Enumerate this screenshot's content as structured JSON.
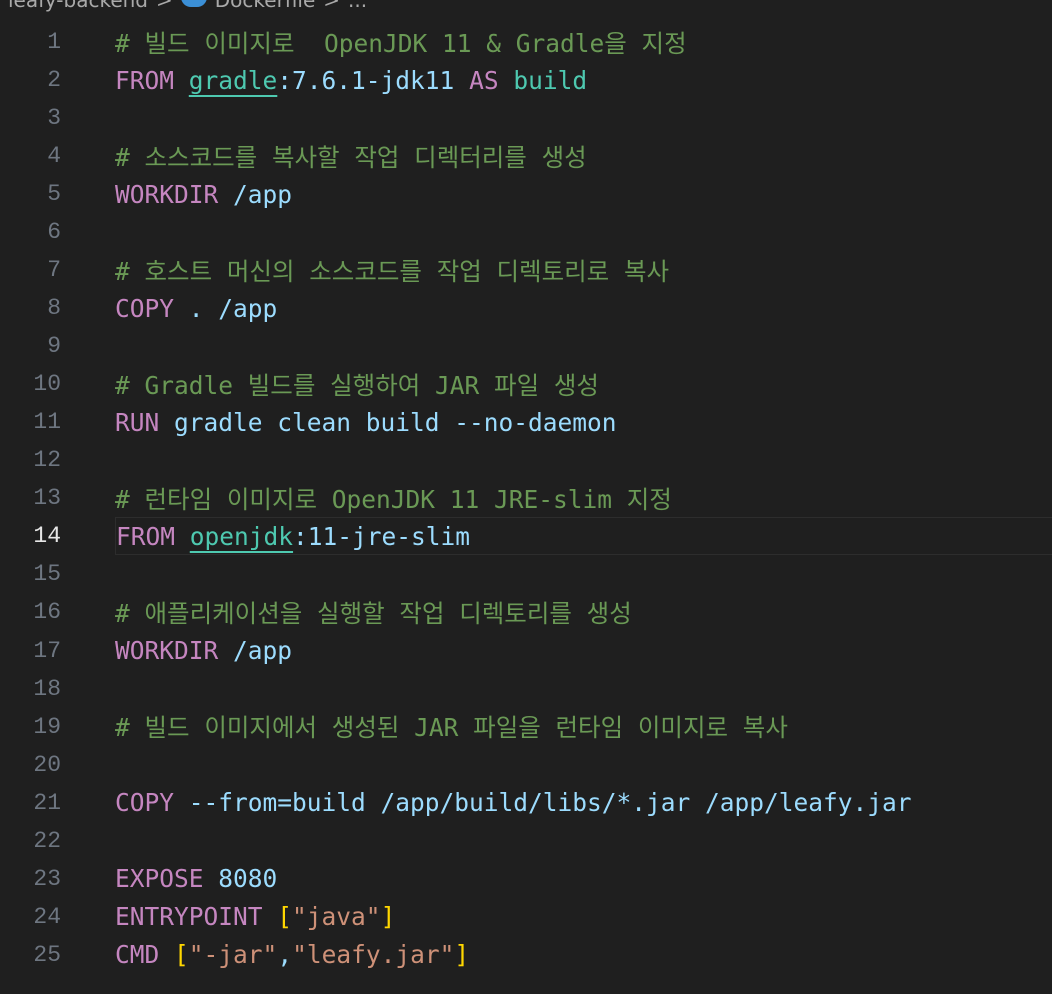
{
  "breadcrumb": {
    "folder": "leafy-backend",
    "separator": ">",
    "file": "Dockerfile",
    "more": "...",
    "file_icon": "docker-icon"
  },
  "editor": {
    "current_line": 14,
    "colors": {
      "keyword": "#C586C0",
      "comment": "#6A9955",
      "text": "#9CDCFE",
      "type": "#4EC9B0",
      "string": "#CE9178",
      "bracket": "#FFD700"
    },
    "lines": [
      {
        "n": "1",
        "tokens": [
          [
            "# 빌드 이미지로  OpenJDK 11 & Gradle을 지정",
            "cm"
          ]
        ]
      },
      {
        "n": "2",
        "tokens": [
          [
            "FROM",
            "kw"
          ],
          [
            " ",
            "tx"
          ],
          [
            "gradle",
            "ul"
          ],
          [
            ":7.6.1-jdk11 ",
            "tx"
          ],
          [
            "AS",
            "kw"
          ],
          [
            " ",
            "tx"
          ],
          [
            "build",
            "ty"
          ]
        ]
      },
      {
        "n": "3",
        "tokens": []
      },
      {
        "n": "4",
        "tokens": [
          [
            "# 소스코드를 복사할 작업 디렉터리를 생성",
            "cm"
          ]
        ]
      },
      {
        "n": "5",
        "tokens": [
          [
            "WORKDIR",
            "kw"
          ],
          [
            " /app",
            "tx"
          ]
        ]
      },
      {
        "n": "6",
        "tokens": []
      },
      {
        "n": "7",
        "tokens": [
          [
            "# 호스트 머신의 소스코드를 작업 디렉토리로 복사",
            "cm"
          ]
        ]
      },
      {
        "n": "8",
        "tokens": [
          [
            "COPY",
            "kw"
          ],
          [
            " . /app",
            "tx"
          ]
        ]
      },
      {
        "n": "9",
        "tokens": []
      },
      {
        "n": "10",
        "tokens": [
          [
            "# Gradle 빌드를 실행하여 JAR 파일 생성",
            "cm"
          ]
        ]
      },
      {
        "n": "11",
        "tokens": [
          [
            "RUN",
            "kw"
          ],
          [
            " gradle clean build --no-daemon",
            "tx"
          ]
        ]
      },
      {
        "n": "12",
        "tokens": []
      },
      {
        "n": "13",
        "tokens": [
          [
            "# 런타임 이미지로 OpenJDK 11 JRE-slim 지정",
            "cm"
          ]
        ]
      },
      {
        "n": "14",
        "tokens": [
          [
            "FROM",
            "kw"
          ],
          [
            " ",
            "tx"
          ],
          [
            "openjdk",
            "ul"
          ],
          [
            ":11-jre-slim",
            "tx"
          ]
        ]
      },
      {
        "n": "15",
        "tokens": []
      },
      {
        "n": "16",
        "tokens": [
          [
            "# 애플리케이션을 실행할 작업 디렉토리를 생성",
            "cm"
          ]
        ]
      },
      {
        "n": "17",
        "tokens": [
          [
            "WORKDIR",
            "kw"
          ],
          [
            " /app",
            "tx"
          ]
        ]
      },
      {
        "n": "18",
        "tokens": []
      },
      {
        "n": "19",
        "tokens": [
          [
            "# 빌드 이미지에서 생성된 JAR 파일을 런타임 이미지로 복사",
            "cm"
          ]
        ]
      },
      {
        "n": "20",
        "tokens": []
      },
      {
        "n": "21",
        "tokens": [
          [
            "COPY",
            "kw"
          ],
          [
            " --from=build /app/build/libs/*.jar /app/leafy.jar",
            "tx"
          ]
        ]
      },
      {
        "n": "22",
        "tokens": []
      },
      {
        "n": "23",
        "tokens": [
          [
            "EXPOSE",
            "kw"
          ],
          [
            " ",
            "tx"
          ],
          [
            "8080",
            "tx"
          ]
        ]
      },
      {
        "n": "24",
        "tokens": [
          [
            "ENTRYPOINT",
            "kw"
          ],
          [
            " ",
            "tx"
          ],
          [
            "[",
            "br"
          ],
          [
            "\"java\"",
            "st"
          ],
          [
            "]",
            "br"
          ]
        ]
      },
      {
        "n": "25",
        "tokens": [
          [
            "CMD",
            "kw"
          ],
          [
            " ",
            "tx"
          ],
          [
            "[",
            "br"
          ],
          [
            "\"-jar\"",
            "st"
          ],
          [
            ",",
            "tx"
          ],
          [
            "\"leafy.jar\"",
            "st"
          ],
          [
            "]",
            "br"
          ]
        ]
      }
    ]
  }
}
